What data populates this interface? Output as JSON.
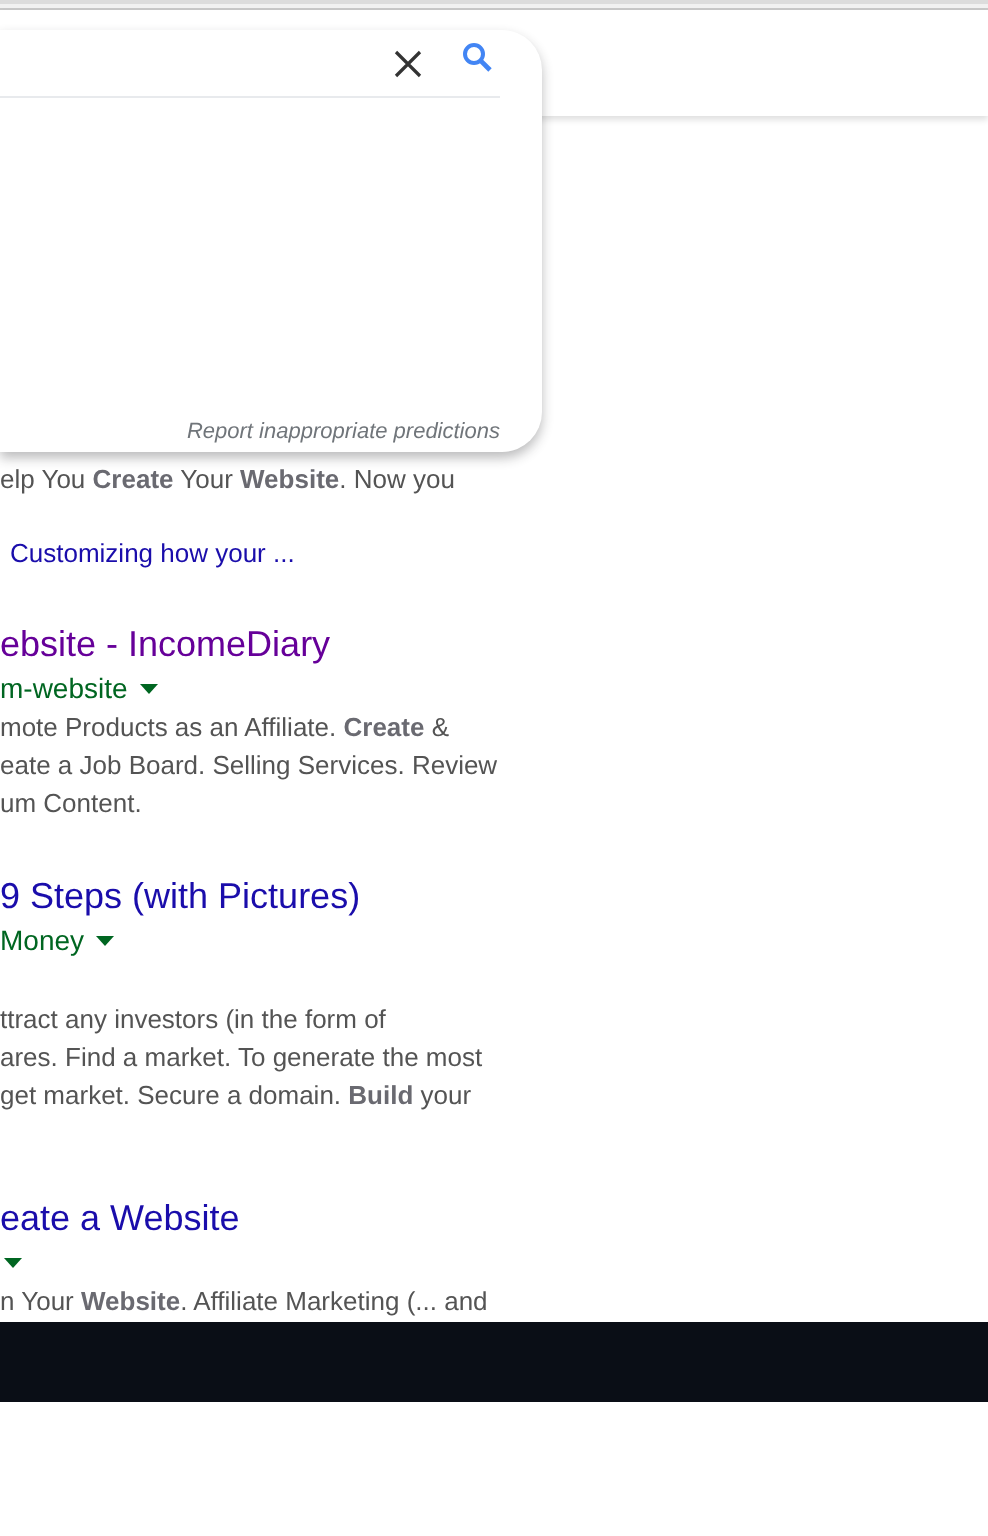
{
  "search_dropdown": {
    "report_link": "Report inappropriate predictions"
  },
  "results": [
    {
      "snippet": [
        "elp You **Create** Your **Website**. Now you"
      ],
      "sitelink": "Customizing how your ..."
    },
    {
      "title": "ebsite - IncomeDiary",
      "visited": true,
      "url": "m-website",
      "menu_caret": true,
      "snippet": [
        "mote Products as an Affiliate. **Create** &",
        "eate a Job Board. Selling Services. Review",
        "um Content."
      ]
    },
    {
      "title": " 9 Steps (with Pictures)",
      "visited": false,
      "url": "Money",
      "menu_caret": true,
      "snippet": [
        "ttract any investors (in the form of",
        "ares. Find a market. To generate the most",
        "get market. Secure a domain. **Build** your"
      ]
    },
    {
      "title": "eate a Website",
      "visited": false,
      "menu_caret": true,
      "snippet": [
        "n Your **Website**. Affiliate Marketing (... and"
      ]
    }
  ]
}
